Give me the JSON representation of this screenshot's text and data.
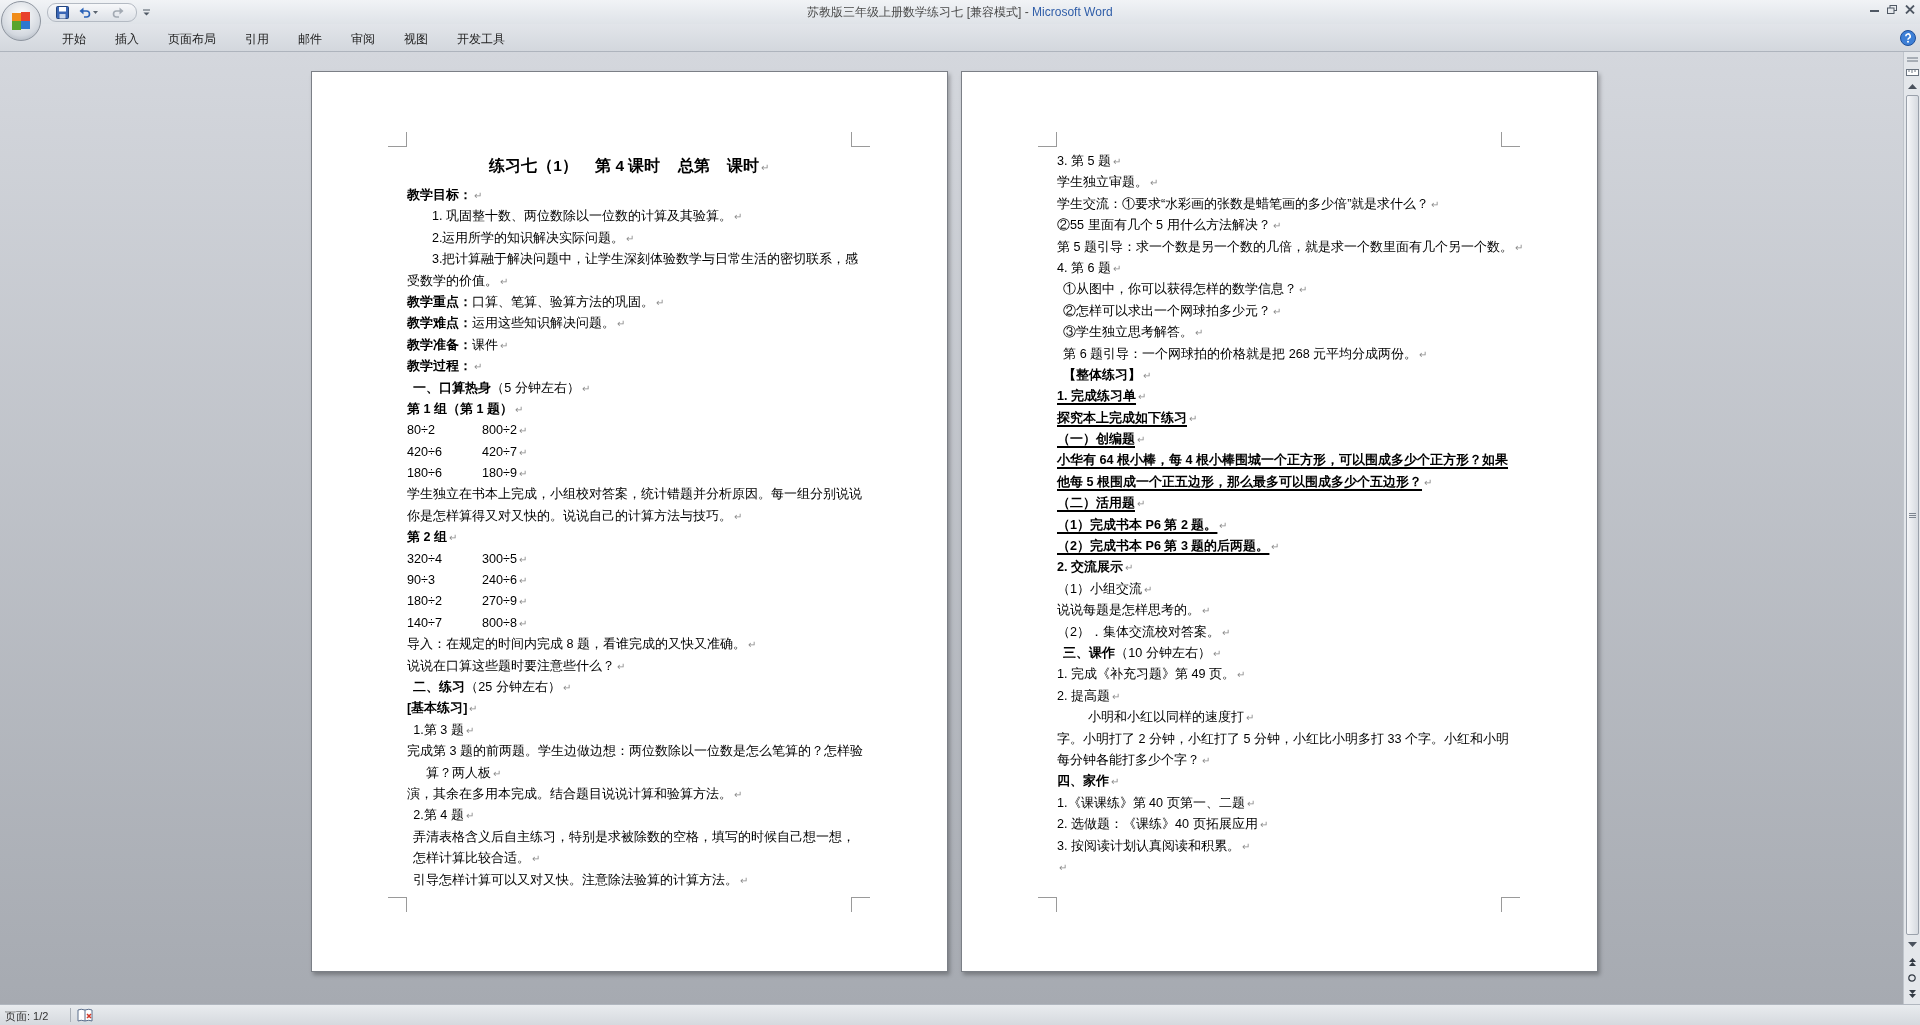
{
  "window": {
    "document_title": "苏教版三年级上册数学练习七 [兼容模式]",
    "separator": "-",
    "app_name": "Microsoft Word"
  },
  "ribbon": {
    "tabs": [
      {
        "label": "开始",
        "selected": false
      },
      {
        "label": "插入",
        "selected": false
      },
      {
        "label": "页面布局",
        "selected": false
      },
      {
        "label": "引用",
        "selected": false
      },
      {
        "label": "邮件",
        "selected": false
      },
      {
        "label": "审阅",
        "selected": false
      },
      {
        "label": "视图",
        "selected": false
      },
      {
        "label": "开发工具",
        "selected": false
      }
    ]
  },
  "pages": [
    {
      "lines": [
        {
          "kind": "title",
          "text": "练习七（1）    第 4 课时    总第    课时",
          "mark": "↵"
        },
        {
          "kind": "heading",
          "text": "教学目标：",
          "mark": "↵"
        },
        {
          "kind": "text",
          "text": "    1. 巩固整十数、两位数除以一位数的计算及其验算。",
          "mark": "↵"
        },
        {
          "kind": "text",
          "text": "    2.运用所学的知识解决实际问题。",
          "mark": "↵"
        },
        {
          "kind": "text",
          "text": "    3.把计算融于解决问题中，让学生深刻体验数学与日常生活的密切联系，感"
        },
        {
          "kind": "text",
          "text": "受数学的价值。",
          "mark": "↵"
        },
        {
          "kind": "text",
          "text": "**教学重点：**口算、笔算、验算方法的巩固。",
          "mark": "↵"
        },
        {
          "kind": "text",
          "text": "**教学难点：**运用这些知识解决问题。",
          "mark": "↵"
        },
        {
          "kind": "text",
          "text": "**教学准备：**课件",
          "mark": "↵"
        },
        {
          "kind": "heading",
          "text": "教学过程：",
          "mark": "↵"
        },
        {
          "kind": "text",
          "text": " **一、口算热身**（5 分钟左右）",
          "mark": "↵"
        },
        {
          "kind": "heading",
          "text": "第 1 组（第 1 题）",
          "mark": "↵"
        },
        {
          "kind": "pair",
          "cells": [
            "80÷2",
            "800÷2"
          ],
          "mark": "↵"
        },
        {
          "kind": "pair",
          "cells": [
            "420÷6",
            "420÷7"
          ],
          "mark": "↵"
        },
        {
          "kind": "pair",
          "cells": [
            "180÷6",
            "180÷9"
          ],
          "mark": "↵"
        },
        {
          "kind": "text",
          "text": "学生独立在书本上完成，小组校对答案，统计错题并分析原因。每一组分别说说"
        },
        {
          "kind": "text",
          "text": "你是怎样算得又对又快的。说说自己的计算方法与技巧。",
          "mark": "↵"
        },
        {
          "kind": "heading",
          "text": "第 2 组",
          "mark": "↵"
        },
        {
          "kind": "pair",
          "cells": [
            "320÷4",
            "300÷5"
          ],
          "mark": "↵"
        },
        {
          "kind": "pair",
          "cells": [
            "90÷3",
            "240÷6"
          ],
          "mark": "↵"
        },
        {
          "kind": "pair",
          "cells": [
            "180÷2",
            "270÷9"
          ],
          "mark": "↵"
        },
        {
          "kind": "pair",
          "cells": [
            "140÷7",
            "800÷8"
          ],
          "mark": "↵"
        },
        {
          "kind": "text",
          "text": "导入：在规定的时间内完成 8 题，看谁完成的又快又准确。",
          "mark": "↵"
        },
        {
          "kind": "text",
          "text": "说说在口算这些题时要注意些什么？",
          "mark": "↵"
        },
        {
          "kind": "text",
          "text": " **二、练习**（25 分钟左右）",
          "mark": "↵"
        },
        {
          "kind": "heading",
          "text": "[基本练习]",
          "mark": "↵"
        },
        {
          "kind": "text",
          "text": " 1.第 3 题",
          "mark": "↵"
        },
        {
          "kind": "text",
          "text": "完成第 3 题的前两题。学生边做边想：两位数除以一位数是怎么笔算的？怎样验"
        },
        {
          "kind": "text",
          "text": "   算？两人板",
          "mark": "↵"
        },
        {
          "kind": "text",
          "text": "演，其余在多用本完成。结合题目说说计算和验算方法。",
          "mark": "↵"
        },
        {
          "kind": "text",
          "text": " 2.第 4 题",
          "mark": "↵"
        },
        {
          "kind": "text",
          "text": " 弄清表格含义后自主练习，特别是求被除数的空格，填写的时候自己想一想，"
        },
        {
          "kind": "text",
          "text": " 怎样计算比较合适。",
          "mark": "↵"
        },
        {
          "kind": "text",
          "text": " 引导怎样计算可以又对又快。注意除法验算的计算方法。",
          "mark": "↵"
        }
      ]
    },
    {
      "lines": [
        {
          "kind": "text",
          "text": "3. 第 5 题",
          "mark": "↵"
        },
        {
          "kind": "text",
          "text": "学生独立审题。",
          "mark": "↵"
        },
        {
          "kind": "text",
          "text": "学生交流：①要求“水彩画的张数是蜡笔画的多少倍”就是求什么？",
          "mark": "↵"
        },
        {
          "kind": "text",
          "text": "②55 里面有几个 5 用什么方法解决？",
          "mark": "↵"
        },
        {
          "kind": "text",
          "text": "第 5 题引导：求一个数是另一个数的几倍，就是求一个数里面有几个另一个数。",
          "mark": "↵"
        },
        {
          "kind": "text",
          "text": "4. 第 6 题",
          "mark": "↵"
        },
        {
          "kind": "text",
          "text": " ①从图中，你可以获得怎样的数学信息？",
          "mark": "↵"
        },
        {
          "kind": "text",
          "text": " ②怎样可以求出一个网球拍多少元？",
          "mark": "↵"
        },
        {
          "kind": "text",
          "text": " ③学生独立思考解答。",
          "mark": "↵"
        },
        {
          "kind": "text",
          "text": " 第 6 题引导：一个网球拍的价格就是把 268 元平均分成两份。",
          "mark": "↵"
        },
        {
          "kind": "heading",
          "text": " 【整体练习】",
          "mark": "↵"
        },
        {
          "kind": "underlined",
          "text": "1. 完成练习单",
          "mark": "↵"
        },
        {
          "kind": "underlined",
          "text": "探究本上完成如下练习",
          "mark": "↵"
        },
        {
          "kind": "underlined",
          "text": "（一）创编题",
          "mark": "↵"
        },
        {
          "kind": "underlined",
          "text": "小华有 64 根小棒，每 4 根小棒围城一个正方形，可以围成多少个正方形？如果"
        },
        {
          "kind": "underlined",
          "text": "他每 5 根围成一个正五边形，那么最多可以围成多少个五边形？",
          "mark": "↵"
        },
        {
          "kind": "underlined",
          "text": "（二）活用题",
          "mark": "↵"
        },
        {
          "kind": "underlined",
          "text": "（1）完成书本 P6 第 2 题。",
          "mark": "↵"
        },
        {
          "kind": "underlined",
          "text": "（2）完成书本 P6 第 3 题的后两题。",
          "mark": "↵"
        },
        {
          "kind": "heading",
          "text": "2. 交流展示",
          "mark": "↵"
        },
        {
          "kind": "text",
          "text": "（1）小组交流",
          "mark": "↵"
        },
        {
          "kind": "text",
          "text": "说说每题是怎样思考的。",
          "mark": "↵"
        },
        {
          "kind": "text",
          "text": "（2）．集体交流校对答案。",
          "mark": "↵"
        },
        {
          "kind": "text",
          "text": " **三、课作**（10 分钟左右）",
          "mark": "↵"
        },
        {
          "kind": "text",
          "text": "1. 完成《补充习题》第 49 页。",
          "mark": "↵"
        },
        {
          "kind": "text",
          "text": "2. 提高题",
          "mark": "↵"
        },
        {
          "kind": "text",
          "text": "     小明和小红以同样的速度打",
          "mark": "↵"
        },
        {
          "kind": "text",
          "text": "字。小明打了 2 分钟，小红打了 5 分钟，小红比小明多打 33 个字。小红和小明"
        },
        {
          "kind": "text",
          "text": "每分钟各能打多少个字？",
          "mark": "↵"
        },
        {
          "kind": "heading",
          "text": "四、家作",
          "mark": "↵"
        },
        {
          "kind": "text",
          "text": "1.《课课练》第 40 页第一、二题",
          "mark": "↵"
        },
        {
          "kind": "text",
          "text": "2. 选做题：《课练》40 页拓展应用",
          "mark": "↵"
        },
        {
          "kind": "text",
          "text": "3. 按阅读计划认真阅读和积累。",
          "mark": "↵"
        },
        {
          "kind": "blank",
          "mark": "↵"
        }
      ]
    }
  ],
  "status_bar": {
    "page_info": "页面: 1/2"
  }
}
